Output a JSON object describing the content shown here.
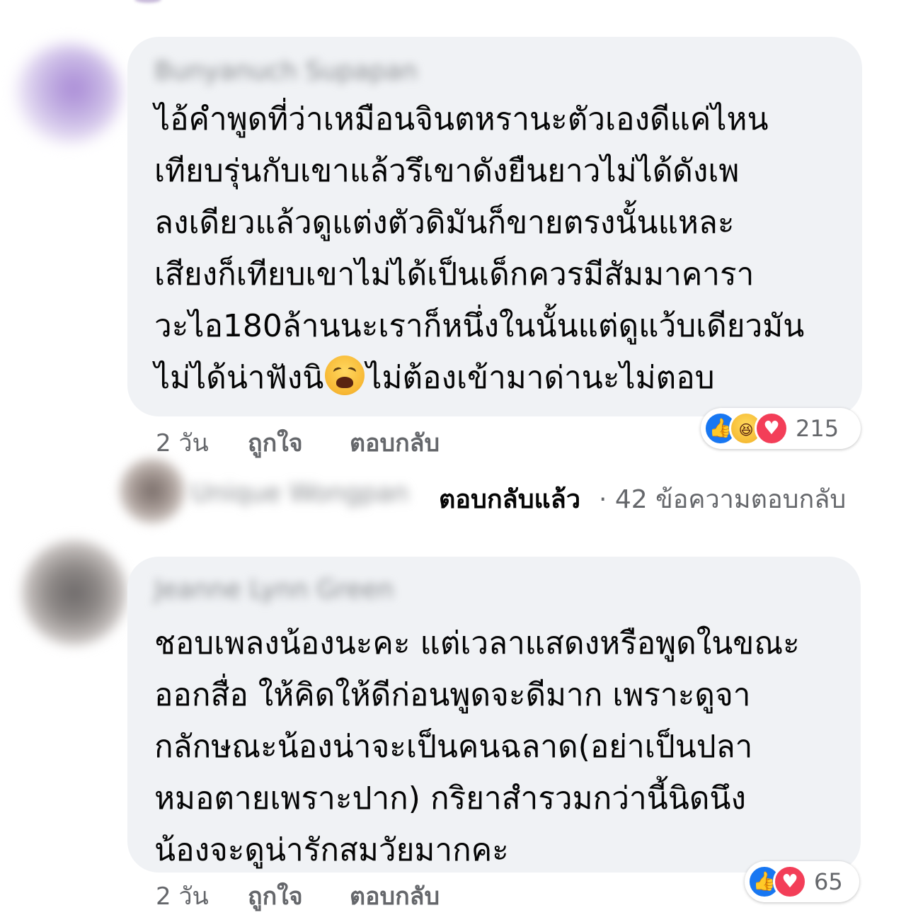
{
  "comments": [
    {
      "author_blurred": "Bunyanuch Supapan",
      "text": "ไอ้คำพูดที่ว่าเหมือนจินตหรานะตัวเองดีแค่ไหน\nเทียบรุ่นกับเขาแล้วรึเขาดังยืนยาวไม่ได้ดังเพ\nลงเดียวแล้วดูแต่งตัวดิมันก็ขายตรงนั้นแหละ\nเสียงก็เทียบเขาไม่ได้เป็นเด็กควรมีสัมมาคารา\nวะไอ180ล้านนะเราก็หนึ่งในนั้นแต่ดูแว้บเดียวมัน\nไม่ได้น่าฟังนิ",
      "text_after_emoji": "ไม่ต้องเข้ามาด่านะไม่ตอบ",
      "emoji": "weary-face-emoji",
      "time": "2 วัน",
      "like_label": "ถูกใจ",
      "reply_label": "ตอบกลับ",
      "reactions": [
        "like",
        "haha",
        "love"
      ],
      "reaction_count": "215",
      "replies": {
        "replier_blurred": "Unique Wongpan",
        "replied_label": "ตอบกลับแล้ว",
        "count_text": "· 42 ข้อความตอบกลับ"
      }
    },
    {
      "author_blurred": "Jeanne Lynn Green",
      "text": "ชอบเพลงน้องนะคะ แต่เวลาแสดงหรือพูดในขณะ\nออกสื่อ ให้คิดให้ดีก่อนพูดจะดีมาก เพราะดูจา\nกลักษณะน้องน่าจะเป็นคนฉลาด(อย่าเป็นปลา\nหมอตายเพราะปาก) กริยาสำรวมกว่านี้นิดนึง\nน้องจะดูน่ารักสมวัยมากคะ",
      "time": "2 วัน",
      "like_label": "ถูกใจ",
      "reply_label": "ตอบกลับ",
      "reactions": [
        "like",
        "love"
      ],
      "reaction_count": "65"
    }
  ],
  "colors": {
    "bubble_bg": "#f0f2f5",
    "meta_text": "#65676b",
    "like_blue": "#1877f2",
    "love_red": "#f33e58",
    "haha_yellow": "#f5b831"
  }
}
